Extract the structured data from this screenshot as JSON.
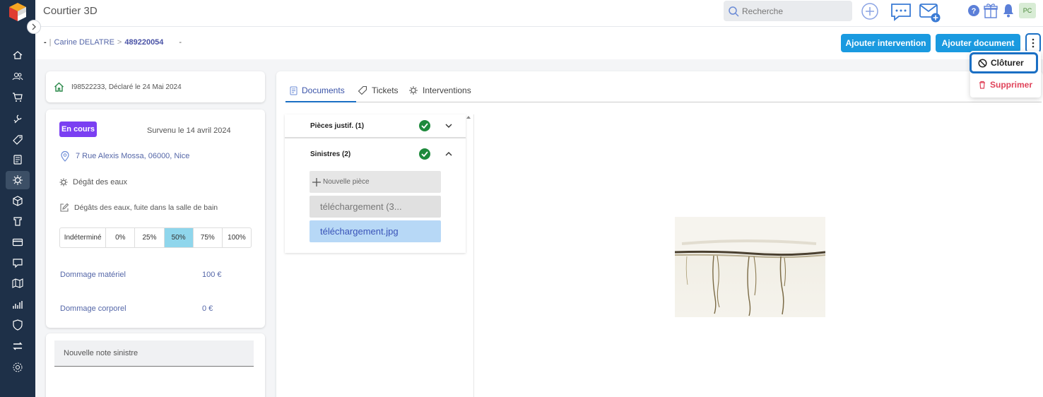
{
  "app": {
    "title": "Courtier 3D"
  },
  "search": {
    "placeholder": "Recherche"
  },
  "header": {
    "avatar": "PC"
  },
  "breadcrumb": {
    "dash": "-",
    "pipe": "|",
    "client": "Carine DELATRE",
    "separator": ">",
    "number": "489220054",
    "dash2": "-"
  },
  "actions": {
    "add_intervention": "Ajouter intervention",
    "add_document": "Ajouter document",
    "more": "⋮"
  },
  "menu": {
    "close": "Clôturer",
    "delete": "Supprimer"
  },
  "claim": {
    "reference": "I98522233, Déclaré le 24 Mai 2024",
    "status": "En cours",
    "occurred": "Survenu le 14 avril 2024",
    "address": "7 Rue Alexis Mossa, 06000, Nice",
    "type": "Dégât des eaux",
    "description": "Dégâts des eaux, fuite dans la salle de bain",
    "responsibility_options": [
      "Indéterminé",
      "0%",
      "25%",
      "50%",
      "75%",
      "100%"
    ],
    "responsibility_selected": "50%",
    "material_damage_label": "Dommage matériel",
    "material_damage_value": "100 €",
    "bodily_damage_label": "Dommage corporel",
    "bodily_damage_value": "0 €",
    "note_placeholder": "Nouvelle note sinistre"
  },
  "tabs": [
    {
      "label": "Documents",
      "active": true
    },
    {
      "label": "Tickets",
      "active": false
    },
    {
      "label": "Interventions",
      "active": false
    }
  ],
  "documents": {
    "groups": [
      {
        "title": "Pièces justif. (1)",
        "expanded": false
      },
      {
        "title": "Sinistres (2)",
        "expanded": true
      }
    ],
    "new_file": "Nouvelle pièce",
    "files": [
      "téléchargement (3...",
      "téléchargement.jpg"
    ],
    "selected_file": "téléchargement.jpg"
  },
  "colors": {
    "sidebar": "#1e3048",
    "primary": "#1a9ae0",
    "accent": "#7b3ff2",
    "delete": "#e0435a"
  }
}
